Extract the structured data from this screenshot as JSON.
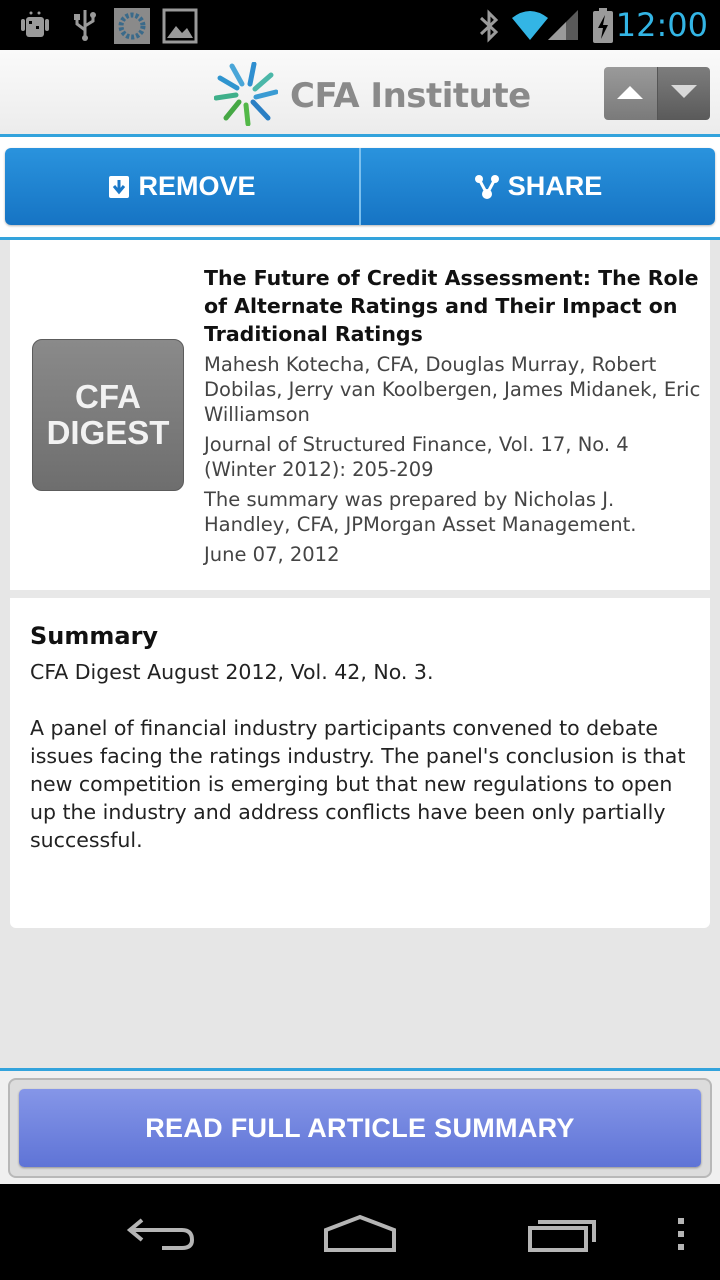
{
  "status_bar": {
    "time": "12:00",
    "icons": [
      "android-debug-icon",
      "usb-icon",
      "app-notification-icon",
      "gallery-icon",
      "bluetooth-icon",
      "wifi-icon",
      "signal-icon",
      "battery-charging-icon"
    ]
  },
  "header": {
    "logo_text": "CFA Institute",
    "logo_icon": "cfa-logo-icon",
    "prev_icon": "arrow-up-icon",
    "next_icon": "arrow-down-icon"
  },
  "actions": {
    "remove_label": "REMOVE",
    "share_label": "SHARE",
    "accent_color": "#1f84d1"
  },
  "article": {
    "thumbnail_line1": "CFA",
    "thumbnail_line2": "DIGEST",
    "title": "The Future of Credit Assessment: The Role of Alternate Ratings and Their Impact on Traditional Ratings",
    "authors": "Mahesh Kotecha, CFA, Douglas Murray, Robert Dobilas, Jerry van Koolbergen, James Midanek, Eric Williamson",
    "journal": "Journal of Structured Finance, Vol. 17, No. 4 (Winter 2012): 205-209",
    "prepared_by": "The summary was prepared by Nicholas J. Handley, CFA, JPMorgan Asset Management.",
    "date": "June 07, 2012"
  },
  "summary": {
    "heading": "Summary",
    "source": "CFA Digest August 2012, Vol. 42, No. 3.",
    "body": "A panel of financial industry participants convened to debate issues facing the ratings industry. The panel's conclusion is that new competition is emerging but that new regulations to open up the industry and address conflicts have been only partially successful."
  },
  "footer": {
    "read_button_label": "READ FULL ARTICLE SUMMARY",
    "button_color": "#6b7fdc"
  },
  "nav_bar": {
    "icons": [
      "back-icon",
      "home-icon",
      "recent-apps-icon",
      "overflow-menu-icon"
    ]
  }
}
